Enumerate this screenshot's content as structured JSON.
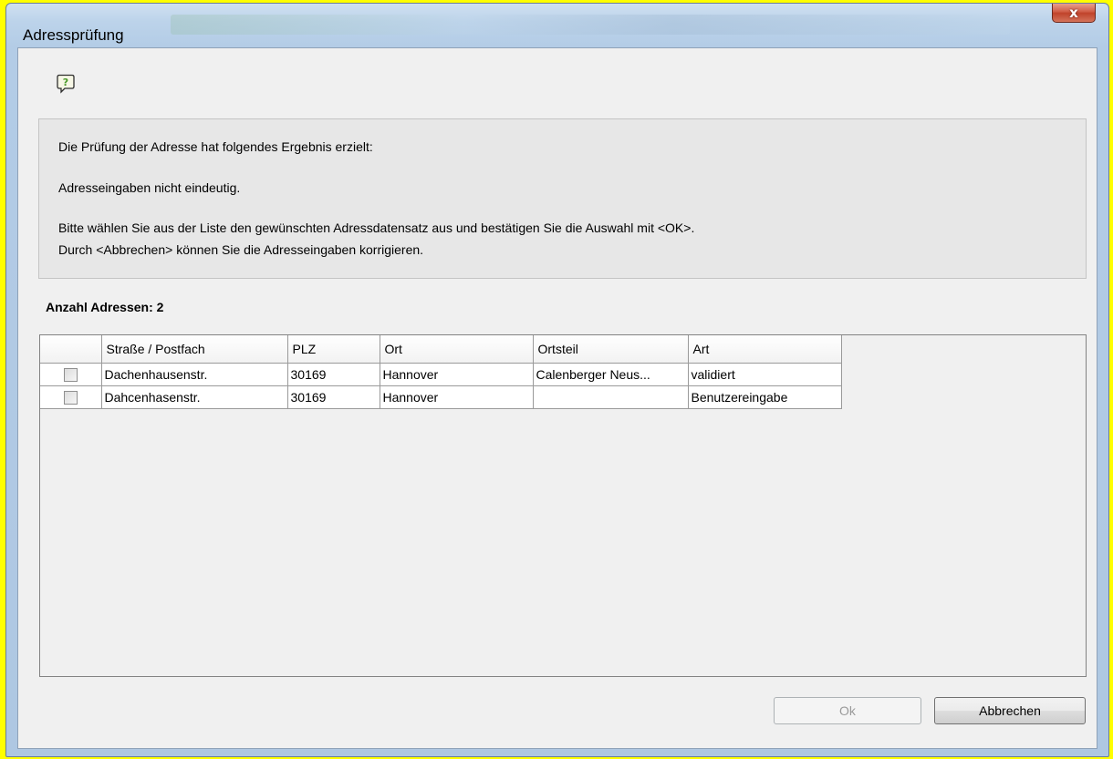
{
  "window": {
    "title": "Adressprüfung",
    "close_label": "x"
  },
  "info": {
    "line1": "Die Prüfung der Adresse hat folgendes Ergebnis erzielt:",
    "line2": "Adresseingaben nicht eindeutig.",
    "line3": "Bitte wählen Sie aus der Liste den gewünschten Adressdatensatz aus und bestätigen Sie die Auswahl mit <OK>.",
    "line4": "Durch <Abbrechen> können Sie die Adresseingaben korrigieren."
  },
  "count_label": "Anzahl Adressen: 2",
  "table": {
    "columns": [
      "",
      "Straße / Postfach",
      "PLZ",
      "Ort",
      "Ortsteil",
      "Art"
    ],
    "rows": [
      {
        "checked": false,
        "strasse": "Dachenhausenstr.",
        "plz": "30169",
        "ort": "Hannover",
        "ortsteil": "Calenberger Neus...",
        "art": "validiert"
      },
      {
        "checked": false,
        "strasse": "Dahcenhasenstr.",
        "plz": "30169",
        "ort": "Hannover",
        "ortsteil": "",
        "art": "Benutzereingabe"
      }
    ]
  },
  "buttons": {
    "ok": "Ok",
    "cancel": "Abbrechen"
  },
  "colors": {
    "client_bg": "#f0f0f0",
    "close_red": "#c0432b"
  }
}
